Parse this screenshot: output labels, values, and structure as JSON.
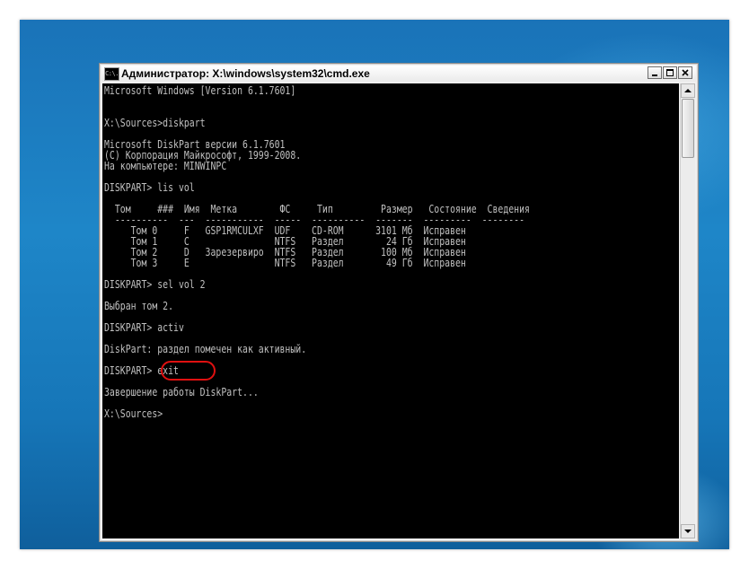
{
  "window": {
    "title": "Администратор: X:\\windows\\system32\\cmd.exe",
    "icon_text": "C:\\."
  },
  "console": {
    "lines": [
      "Microsoft Windows [Version 6.1.7601]",
      "",
      "",
      "X:\\Sources>diskpart",
      "",
      "Microsoft DiskPart версии 6.1.7601",
      "(C) Корпорация Майкрософт, 1999-2008.",
      "На компьютере: MINWINPC",
      "",
      "DISKPART> lis vol",
      "",
      "  Том     ###  Имя  Метка        ФС     Тип         Размер   Состояние  Сведения",
      "  ----------  ---  -----------  -----  ----------  -------  ---------  --------",
      "     Том 0     F   GSP1RMCULXF  UDF    CD-ROM      3101 Мб  Исправен",
      "     Том 1     C                NTFS   Раздел        24 Гб  Исправен",
      "     Том 2     D   Зарезервиро  NTFS   Раздел       100 Мб  Исправен",
      "     Том 3     E                NTFS   Раздел        49 Гб  Исправен",
      "",
      "DISKPART> sel vol 2",
      "",
      "Выбран том 2.",
      "",
      "DISKPART> activ",
      "",
      "DiskPart: раздел помечен как активный.",
      "",
      "DISKPART> exit",
      "",
      "Завершение работы DiskPart...",
      "",
      "X:\\Sources>"
    ]
  },
  "colors": {
    "console_bg": "#000000",
    "console_fg": "#c0c0c0",
    "highlight": "#e01010",
    "desktop": "#1e86c8"
  },
  "icons": [
    "cmd-app-icon",
    "minimize-icon",
    "maximize-icon",
    "close-icon",
    "scroll-up-icon",
    "scroll-down-icon"
  ]
}
